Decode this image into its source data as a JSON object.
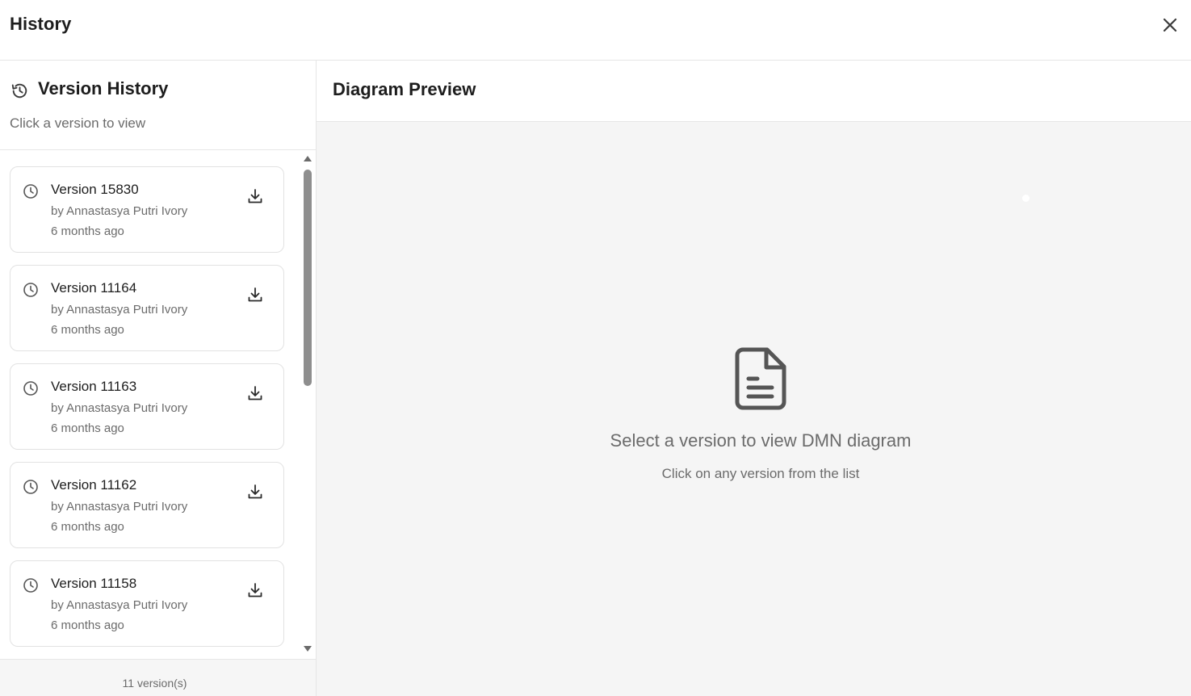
{
  "dialog": {
    "title": "History",
    "close_icon": "close-icon"
  },
  "sidebar": {
    "title": "Version History",
    "title_icon": "history-icon",
    "subtitle": "Click a version to view",
    "versions": [
      {
        "name": "Version 15830",
        "author": "by Annastasya Putri Ivory",
        "time": "6 months ago"
      },
      {
        "name": "Version 11164",
        "author": "by Annastasya Putri Ivory",
        "time": "6 months ago"
      },
      {
        "name": "Version 11163",
        "author": "by Annastasya Putri Ivory",
        "time": "6 months ago"
      },
      {
        "name": "Version 11162",
        "author": "by Annastasya Putri Ivory",
        "time": "6 months ago"
      },
      {
        "name": "Version 11158",
        "author": "by Annastasya Putri Ivory",
        "time": "6 months ago"
      }
    ],
    "footer_count": "11 version(s)"
  },
  "preview": {
    "title": "Diagram Preview",
    "empty_icon": "document-icon",
    "empty_title": "Select a version to view DMN diagram",
    "empty_subtitle": "Click on any version from the list"
  },
  "colors": {
    "text_primary": "#1d1d1d",
    "text_secondary": "#6b6b6b",
    "border": "#e2e2e2",
    "preview_bg": "#f5f5f5"
  }
}
